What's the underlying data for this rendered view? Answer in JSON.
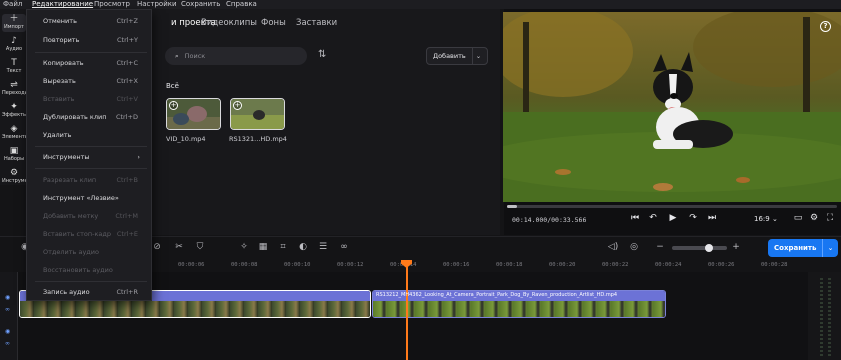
{
  "menubar": {
    "items": [
      "Файл",
      "Редактирование",
      "Просмотр",
      "Настройки",
      "Сохранить",
      "Справка"
    ]
  },
  "leftnav": {
    "items": [
      {
        "label": "Импорт",
        "icon": "plus-icon"
      },
      {
        "label": "Аудио",
        "icon": "music-icon"
      },
      {
        "label": "Текст",
        "icon": "text-icon"
      },
      {
        "label": "Переходы",
        "icon": "transition-icon"
      },
      {
        "label": "Эффекты",
        "icon": "effects-icon"
      },
      {
        "label": "Элементы",
        "icon": "elements-icon"
      },
      {
        "label": "Наборы",
        "icon": "kits-icon"
      },
      {
        "label": "Инструменты",
        "icon": "tools-icon"
      }
    ]
  },
  "media": {
    "tabs": [
      "и проекта",
      "Видеоклипы",
      "Фоны",
      "Заставки"
    ],
    "search_placeholder": "Поиск",
    "add_button": "Добавить",
    "section_label": "Всё",
    "clips": [
      {
        "name": "VID_10.mp4"
      },
      {
        "name": "RS1321...HD.mp4"
      }
    ]
  },
  "preview": {
    "timecode": "00:14.000/00:33.566",
    "ratio": "16:9",
    "progress": 0.03
  },
  "toolbar": {
    "save_label": "Сохранить"
  },
  "ruler": {
    "ticks": [
      "00:00:06",
      "00:00:08",
      "00:00:10",
      "00:00:12",
      "00:00:14",
      "00:00:16",
      "00:00:18",
      "00:00:20",
      "00:00:22",
      "00:00:24",
      "00:00:26",
      "00:00:28"
    ],
    "left_label": "69"
  },
  "timeline": {
    "clip2_title": "RS13212_MH4362_Looking_At_Camera_Portrait_Park_Dog_By_Raven_production_Artlist_HD.mp4"
  },
  "menu": {
    "items": [
      {
        "label": "Отменить",
        "shortcut": "Ctrl+Z",
        "disabled": false
      },
      {
        "label": "Повторить",
        "shortcut": "Ctrl+Y",
        "disabled": false
      },
      {
        "label": "Копировать",
        "shortcut": "Ctrl+C",
        "disabled": false
      },
      {
        "label": "Вырезать",
        "shortcut": "Ctrl+X",
        "disabled": false
      },
      {
        "label": "Вставить",
        "shortcut": "Ctrl+V",
        "disabled": true
      },
      {
        "label": "Дублировать клип",
        "shortcut": "Ctrl+D",
        "disabled": false
      },
      {
        "label": "Удалить",
        "shortcut": "",
        "disabled": false
      },
      {
        "label": "Инструменты",
        "shortcut": "",
        "disabled": false
      },
      {
        "label": "Разрезать клип",
        "shortcut": "Ctrl+B",
        "disabled": true
      },
      {
        "label": "Инструмент «Лезвие»",
        "shortcut": "",
        "disabled": false
      },
      {
        "label": "Добавить метку",
        "shortcut": "Ctrl+M",
        "disabled": true
      },
      {
        "label": "Вставить стоп-кадр",
        "shortcut": "Ctrl+E",
        "disabled": true
      },
      {
        "label": "Отделить аудио",
        "shortcut": "",
        "disabled": true
      },
      {
        "label": "Восстановить аудио",
        "shortcut": "",
        "disabled": true
      },
      {
        "label": "Запись аудио",
        "shortcut": "Ctrl+R",
        "disabled": false
      }
    ]
  }
}
